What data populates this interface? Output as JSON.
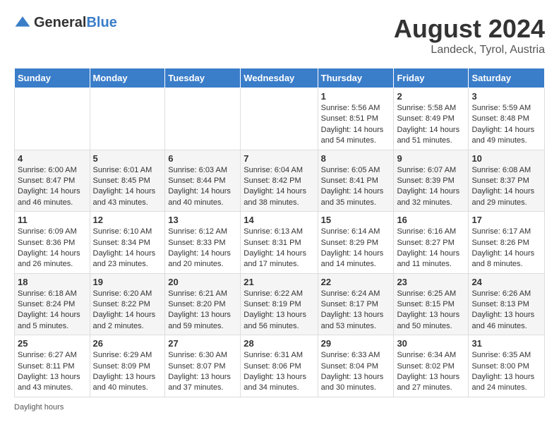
{
  "header": {
    "logo_general": "General",
    "logo_blue": "Blue",
    "month_year": "August 2024",
    "location": "Landeck, Tyrol, Austria"
  },
  "days_of_week": [
    "Sunday",
    "Monday",
    "Tuesday",
    "Wednesday",
    "Thursday",
    "Friday",
    "Saturday"
  ],
  "weeks": [
    [
      {
        "day": "",
        "info": ""
      },
      {
        "day": "",
        "info": ""
      },
      {
        "day": "",
        "info": ""
      },
      {
        "day": "",
        "info": ""
      },
      {
        "day": "1",
        "info": "Sunrise: 5:56 AM\nSunset: 8:51 PM\nDaylight: 14 hours and 54 minutes."
      },
      {
        "day": "2",
        "info": "Sunrise: 5:58 AM\nSunset: 8:49 PM\nDaylight: 14 hours and 51 minutes."
      },
      {
        "day": "3",
        "info": "Sunrise: 5:59 AM\nSunset: 8:48 PM\nDaylight: 14 hours and 49 minutes."
      }
    ],
    [
      {
        "day": "4",
        "info": "Sunrise: 6:00 AM\nSunset: 8:47 PM\nDaylight: 14 hours and 46 minutes."
      },
      {
        "day": "5",
        "info": "Sunrise: 6:01 AM\nSunset: 8:45 PM\nDaylight: 14 hours and 43 minutes."
      },
      {
        "day": "6",
        "info": "Sunrise: 6:03 AM\nSunset: 8:44 PM\nDaylight: 14 hours and 40 minutes."
      },
      {
        "day": "7",
        "info": "Sunrise: 6:04 AM\nSunset: 8:42 PM\nDaylight: 14 hours and 38 minutes."
      },
      {
        "day": "8",
        "info": "Sunrise: 6:05 AM\nSunset: 8:41 PM\nDaylight: 14 hours and 35 minutes."
      },
      {
        "day": "9",
        "info": "Sunrise: 6:07 AM\nSunset: 8:39 PM\nDaylight: 14 hours and 32 minutes."
      },
      {
        "day": "10",
        "info": "Sunrise: 6:08 AM\nSunset: 8:37 PM\nDaylight: 14 hours and 29 minutes."
      }
    ],
    [
      {
        "day": "11",
        "info": "Sunrise: 6:09 AM\nSunset: 8:36 PM\nDaylight: 14 hours and 26 minutes."
      },
      {
        "day": "12",
        "info": "Sunrise: 6:10 AM\nSunset: 8:34 PM\nDaylight: 14 hours and 23 minutes."
      },
      {
        "day": "13",
        "info": "Sunrise: 6:12 AM\nSunset: 8:33 PM\nDaylight: 14 hours and 20 minutes."
      },
      {
        "day": "14",
        "info": "Sunrise: 6:13 AM\nSunset: 8:31 PM\nDaylight: 14 hours and 17 minutes."
      },
      {
        "day": "15",
        "info": "Sunrise: 6:14 AM\nSunset: 8:29 PM\nDaylight: 14 hours and 14 minutes."
      },
      {
        "day": "16",
        "info": "Sunrise: 6:16 AM\nSunset: 8:27 PM\nDaylight: 14 hours and 11 minutes."
      },
      {
        "day": "17",
        "info": "Sunrise: 6:17 AM\nSunset: 8:26 PM\nDaylight: 14 hours and 8 minutes."
      }
    ],
    [
      {
        "day": "18",
        "info": "Sunrise: 6:18 AM\nSunset: 8:24 PM\nDaylight: 14 hours and 5 minutes."
      },
      {
        "day": "19",
        "info": "Sunrise: 6:20 AM\nSunset: 8:22 PM\nDaylight: 14 hours and 2 minutes."
      },
      {
        "day": "20",
        "info": "Sunrise: 6:21 AM\nSunset: 8:20 PM\nDaylight: 13 hours and 59 minutes."
      },
      {
        "day": "21",
        "info": "Sunrise: 6:22 AM\nSunset: 8:19 PM\nDaylight: 13 hours and 56 minutes."
      },
      {
        "day": "22",
        "info": "Sunrise: 6:24 AM\nSunset: 8:17 PM\nDaylight: 13 hours and 53 minutes."
      },
      {
        "day": "23",
        "info": "Sunrise: 6:25 AM\nSunset: 8:15 PM\nDaylight: 13 hours and 50 minutes."
      },
      {
        "day": "24",
        "info": "Sunrise: 6:26 AM\nSunset: 8:13 PM\nDaylight: 13 hours and 46 minutes."
      }
    ],
    [
      {
        "day": "25",
        "info": "Sunrise: 6:27 AM\nSunset: 8:11 PM\nDaylight: 13 hours and 43 minutes."
      },
      {
        "day": "26",
        "info": "Sunrise: 6:29 AM\nSunset: 8:09 PM\nDaylight: 13 hours and 40 minutes."
      },
      {
        "day": "27",
        "info": "Sunrise: 6:30 AM\nSunset: 8:07 PM\nDaylight: 13 hours and 37 minutes."
      },
      {
        "day": "28",
        "info": "Sunrise: 6:31 AM\nSunset: 8:06 PM\nDaylight: 13 hours and 34 minutes."
      },
      {
        "day": "29",
        "info": "Sunrise: 6:33 AM\nSunset: 8:04 PM\nDaylight: 13 hours and 30 minutes."
      },
      {
        "day": "30",
        "info": "Sunrise: 6:34 AM\nSunset: 8:02 PM\nDaylight: 13 hours and 27 minutes."
      },
      {
        "day": "31",
        "info": "Sunrise: 6:35 AM\nSunset: 8:00 PM\nDaylight: 13 hours and 24 minutes."
      }
    ]
  ],
  "footer": {
    "note": "Daylight hours"
  }
}
